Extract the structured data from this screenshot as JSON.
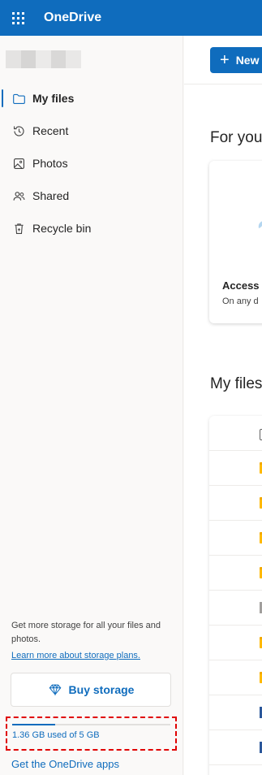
{
  "header": {
    "app_title": "OneDrive"
  },
  "sidebar": {
    "items": [
      {
        "label": "My files",
        "icon": "folder-icon",
        "active": true
      },
      {
        "label": "Recent",
        "icon": "history-icon",
        "active": false
      },
      {
        "label": "Photos",
        "icon": "image-icon",
        "active": false
      },
      {
        "label": "Shared",
        "icon": "people-icon",
        "active": false
      },
      {
        "label": "Recycle bin",
        "icon": "recycle-bin-icon",
        "active": false
      }
    ],
    "promo_text": "Get more storage for all your files and photos.",
    "promo_link": "Learn more about storage plans.",
    "buy_button": "Buy storage",
    "storage": {
      "text": "1.36 GB used of 5 GB",
      "used_fraction": 0.272
    },
    "apps_link": "Get the OneDrive apps"
  },
  "main": {
    "new_button": "New",
    "for_you_title": "For you",
    "card": {
      "title": "Access y",
      "subtitle": "On any d"
    },
    "my_files_title": "My files"
  },
  "colors": {
    "brand": "#0f6cbd",
    "highlight_border": "#e00000"
  }
}
